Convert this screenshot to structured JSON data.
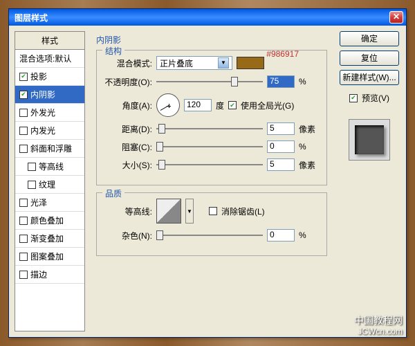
{
  "title": "图层样式",
  "hex_annotation": "#986917",
  "left": {
    "header": "样式",
    "blend_defaults": "混合选项:默认",
    "items": [
      {
        "label": "投影",
        "checked": true,
        "selected": false
      },
      {
        "label": "内阴影",
        "checked": true,
        "selected": true
      },
      {
        "label": "外发光",
        "checked": false,
        "selected": false
      },
      {
        "label": "内发光",
        "checked": false,
        "selected": false
      },
      {
        "label": "斜面和浮雕",
        "checked": false,
        "selected": false
      },
      {
        "label": "等高线",
        "checked": false,
        "selected": false,
        "indent": true
      },
      {
        "label": "纹理",
        "checked": false,
        "selected": false,
        "indent": true
      },
      {
        "label": "光泽",
        "checked": false,
        "selected": false
      },
      {
        "label": "颜色叠加",
        "checked": false,
        "selected": false
      },
      {
        "label": "渐变叠加",
        "checked": false,
        "selected": false
      },
      {
        "label": "图案叠加",
        "checked": false,
        "selected": false
      },
      {
        "label": "描边",
        "checked": false,
        "selected": false
      }
    ]
  },
  "center": {
    "title": "内阴影",
    "structure": {
      "legend": "结构",
      "blend_mode_label": "混合模式:",
      "blend_mode_value": "正片叠底",
      "opacity_label": "不透明度(O):",
      "opacity_value": "75",
      "opacity_unit": "%",
      "angle_label": "角度(A):",
      "angle_value": "120",
      "angle_unit": "度",
      "global_light_label": "使用全局光(G)",
      "distance_label": "距离(D):",
      "distance_value": "5",
      "distance_unit": "像素",
      "choke_label": "阻塞(C):",
      "choke_value": "0",
      "choke_unit": "%",
      "size_label": "大小(S):",
      "size_value": "5",
      "size_unit": "像素"
    },
    "quality": {
      "legend": "品质",
      "contour_label": "等高线:",
      "antialias_label": "消除锯齿(L)",
      "noise_label": "杂色(N):",
      "noise_value": "0",
      "noise_unit": "%"
    }
  },
  "right": {
    "ok": "确定",
    "cancel": "复位",
    "new_style": "新建样式(W)...",
    "preview_label": "预览(V)"
  },
  "watermark": {
    "cn": "中国教程网",
    "url": "JCWcn.com"
  }
}
